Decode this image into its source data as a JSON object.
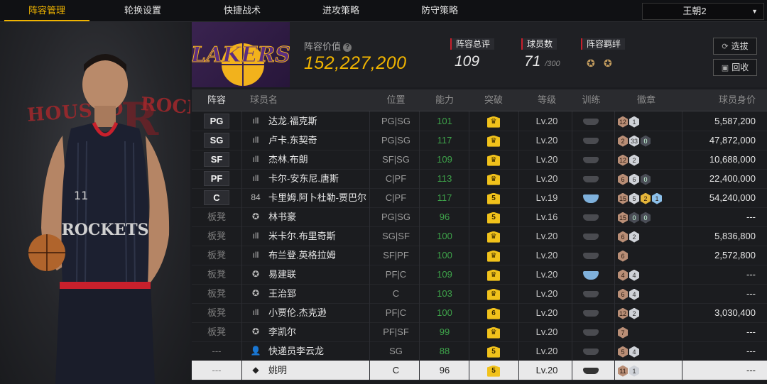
{
  "nav": {
    "tabs": [
      "阵容管理",
      "轮换设置",
      "快捷战术",
      "进攻策略",
      "防守策略"
    ],
    "active_tab": "阵容管理",
    "team_select": "王朝2"
  },
  "left_panel": {
    "backdrop_text_left": "HOUSTO",
    "backdrop_text_right": "ROCK",
    "backdrop_letter": "R"
  },
  "header": {
    "logo_text": "LAKERS",
    "value_label": "阵容价值",
    "value": "152,227,200",
    "stats": {
      "rating_label": "阵容总评",
      "rating": "109",
      "players_label": "球员数",
      "players": "71",
      "players_max": "/300",
      "bond_label": "阵容羁绊"
    },
    "buttons": {
      "select": "选拔",
      "recycle": "回收"
    }
  },
  "table": {
    "columns": [
      "阵容",
      "球员名",
      "位置",
      "能力",
      "突破",
      "等级",
      "训练",
      "徽章",
      "球员身价"
    ],
    "rows": [
      {
        "slot": "PG",
        "icon": "bars",
        "name": "达龙.福克斯",
        "pos": "PG|SG",
        "ability": "101",
        "break": "",
        "level": "Lv.20",
        "train": "gray",
        "badges": [
          [
            "bronze",
            "12"
          ],
          [
            "silver",
            "1"
          ]
        ],
        "salary": "5,587,200"
      },
      {
        "slot": "SG",
        "icon": "bars",
        "name": "卢卡.东契奇",
        "pos": "PG|SG",
        "ability": "117",
        "break": "",
        "level": "Lv.20",
        "train": "gray",
        "badges": [
          [
            "bronze",
            "2"
          ],
          [
            "silver",
            "33"
          ],
          [
            "dark",
            "0"
          ]
        ],
        "salary": "47,872,000"
      },
      {
        "slot": "SF",
        "icon": "bars",
        "name": "杰林.布朗",
        "pos": "SF|SG",
        "ability": "109",
        "break": "",
        "level": "Lv.20",
        "train": "gray",
        "badges": [
          [
            "bronze",
            "12"
          ],
          [
            "silver",
            "2"
          ]
        ],
        "salary": "10,688,000"
      },
      {
        "slot": "PF",
        "icon": "bars",
        "name": "卡尔-安东尼.唐斯",
        "pos": "C|PF",
        "ability": "113",
        "break": "",
        "level": "Lv.20",
        "train": "gray",
        "badges": [
          [
            "bronze",
            "6"
          ],
          [
            "silver",
            "6"
          ],
          [
            "dark",
            "0"
          ]
        ],
        "salary": "22,400,000"
      },
      {
        "slot": "C",
        "icon": "84",
        "name": "卡里姆.阿卜杜勒-贾巴尔",
        "pos": "C|PF",
        "ability": "117",
        "break": "5",
        "level": "Lv.19",
        "train": "blue",
        "badges": [
          [
            "bronze",
            "15"
          ],
          [
            "silver",
            "5"
          ],
          [
            "gold",
            "2"
          ],
          [
            "blue",
            "1"
          ]
        ],
        "salary": "54,240,000"
      },
      {
        "slot": "板凳",
        "icon": "star",
        "name": "林书豪",
        "pos": "PG|SG",
        "ability": "96",
        "break": "5",
        "level": "Lv.16",
        "train": "gray",
        "badges": [
          [
            "bronze",
            "15"
          ],
          [
            "dark",
            "0"
          ],
          [
            "dark",
            "0"
          ]
        ],
        "salary": "---"
      },
      {
        "slot": "板凳",
        "icon": "bars",
        "name": "米卡尔.布里奇斯",
        "pos": "SG|SF",
        "ability": "100",
        "break": "",
        "level": "Lv.20",
        "train": "gray",
        "badges": [
          [
            "bronze",
            "6"
          ],
          [
            "silver",
            "2"
          ]
        ],
        "salary": "5,836,800"
      },
      {
        "slot": "板凳",
        "icon": "bars",
        "name": "布兰登.英格拉姆",
        "pos": "SF|PF",
        "ability": "100",
        "break": "",
        "level": "Lv.20",
        "train": "gray",
        "badges": [
          [
            "bronze",
            "6"
          ]
        ],
        "salary": "2,572,800"
      },
      {
        "slot": "板凳",
        "icon": "star",
        "name": "易建联",
        "pos": "PF|C",
        "ability": "109",
        "break": "",
        "level": "Lv.20",
        "train": "blue",
        "badges": [
          [
            "bronze",
            "4"
          ],
          [
            "silver",
            "4"
          ]
        ],
        "salary": "---"
      },
      {
        "slot": "板凳",
        "icon": "star",
        "name": "王治郅",
        "pos": "C",
        "ability": "103",
        "break": "",
        "level": "Lv.20",
        "train": "gray",
        "badges": [
          [
            "bronze",
            "6"
          ],
          [
            "silver",
            "4"
          ]
        ],
        "salary": "---"
      },
      {
        "slot": "板凳",
        "icon": "bars",
        "name": "小贾伦.杰克逊",
        "pos": "PF|C",
        "ability": "100",
        "break": "6",
        "level": "Lv.20",
        "train": "gray",
        "badges": [
          [
            "bronze",
            "12"
          ],
          [
            "silver",
            "2"
          ]
        ],
        "salary": "3,030,400"
      },
      {
        "slot": "板凳",
        "icon": "star",
        "name": "李凯尔",
        "pos": "PF|SF",
        "ability": "99",
        "break": "",
        "level": "Lv.20",
        "train": "gray",
        "badges": [
          [
            "bronze",
            "7"
          ]
        ],
        "salary": "---"
      },
      {
        "slot": "---",
        "icon": "person",
        "name": "快递员李云龙",
        "pos": "SG",
        "ability": "88",
        "break": "5",
        "level": "Lv.20",
        "train": "gray",
        "badges": [
          [
            "bronze",
            "5"
          ],
          [
            "silver",
            "4"
          ]
        ],
        "salary": "---"
      },
      {
        "slot": "---",
        "icon": "diamond",
        "name": "姚明",
        "pos": "C",
        "ability": "96",
        "break": "5",
        "level": "Lv.20",
        "train": "dark",
        "badges": [
          [
            "bronze",
            "11"
          ],
          [
            "silver",
            "1"
          ]
        ],
        "salary": "---"
      }
    ]
  }
}
